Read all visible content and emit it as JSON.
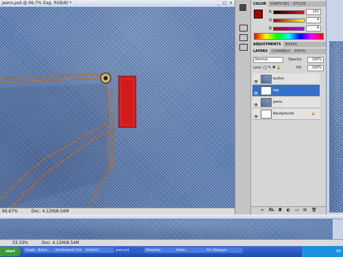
{
  "main_doc": {
    "title": "jeans.psd @ 66.7% (tag, RGB/8) *",
    "zoom": "66.67%",
    "doc_info": "Doc: 4.12M/8.54M"
  },
  "second_doc": {
    "zoom": "33.33%",
    "doc_info": "Doc: 4.12M/8.54M"
  },
  "color_panel": {
    "tabs": [
      "COLOR",
      "SWATCHES",
      "STYLES"
    ],
    "active_tab": "COLOR",
    "fields": [
      {
        "label": "R",
        "value": "162"
      },
      {
        "label": "G",
        "value": "4"
      },
      {
        "label": "B",
        "value": "4"
      }
    ],
    "foreground": "#a20404"
  },
  "adjustments_panel": {
    "tabs": [
      "ADJUSTMENTS",
      "MASKS"
    ]
  },
  "layers_panel": {
    "tabs": [
      "LAYERS",
      "CHANNELS",
      "PATHS"
    ],
    "blend_mode": "Normal",
    "opacity_label": "Opacity:",
    "opacity": "100%",
    "lock_label": "Lock:",
    "fill_label": "Fill:",
    "fill": "100%",
    "layers": [
      {
        "name": "button",
        "selected": false
      },
      {
        "name": "tag",
        "selected": true
      },
      {
        "name": "jeans",
        "selected": false
      },
      {
        "name": "Background",
        "selected": false
      }
    ],
    "footer_icons": [
      "link-icon",
      "fx-icon",
      "mask-icon",
      "adjustment-icon",
      "group-icon",
      "new-layer-icon",
      "trash-icon"
    ]
  },
  "taskbar": {
    "items": [
      "start",
      "Google – Bjsted...",
      "Dreamweaver CS4",
      "Untitled-1",
      "jeans.psd",
      "Photoshop",
      "Adobe...",
      "ACL Wallpaper...",
      "EN"
    ]
  }
}
